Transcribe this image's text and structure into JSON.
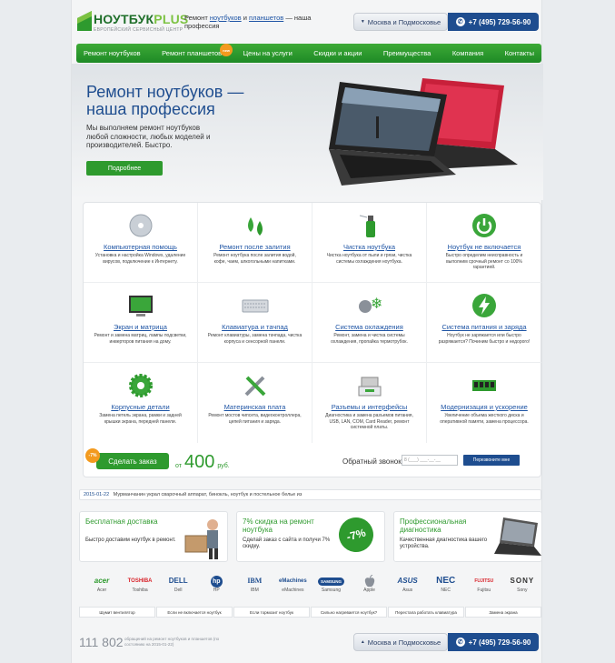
{
  "header": {
    "logo_text": "НОУТБУК",
    "logo_plus": "PLUS",
    "logo_sub": "ЕВРОПЕЙСКИЙ СЕРВИСНЫЙ ЦЕНТР",
    "tagline_pre": "Ремонт ",
    "tagline_link1": "ноутбуков",
    "tagline_mid": " и ",
    "tagline_link2": "планшетов",
    "tagline_post": " — наша профессия",
    "city": "Москва и Подмосковье",
    "phone": "+7 (495) 729-56-90"
  },
  "nav": {
    "items": [
      {
        "label": "Ремонт ноутбуков"
      },
      {
        "label": "Ремонт планшетов",
        "badge": "new"
      },
      {
        "label": "Цены на услуги"
      },
      {
        "label": "Скидки и акции"
      },
      {
        "label": "Преимущества"
      },
      {
        "label": "Компания"
      },
      {
        "label": "Контакты"
      }
    ]
  },
  "hero": {
    "title": "Ремонт ноутбуков — наша профессия",
    "text": "Мы выполняем ремонт ноутбуков любой сложности, любых моделей и производителей. Быстро.",
    "button": "Подробнее"
  },
  "services": [
    {
      "title": "Компьютерная помощь",
      "desc": "Установка и настройка Windows, удаление вирусов, подключение к Интернету.",
      "icon": "disc-icon"
    },
    {
      "title": "Ремонт после залития",
      "desc": "Ремонт ноутбука после залития водой, кофе, чаем, алкогольными напитками.",
      "icon": "drops-icon"
    },
    {
      "title": "Чистка ноутбука",
      "desc": "Чистка ноутбука от пыли и грязи, чистка системы охлаждения ноутбука.",
      "icon": "spray-icon"
    },
    {
      "title": "Ноутбук не включается",
      "desc": "Быстро определим неисправность и выполним срочный ремонт со 100% гарантией.",
      "icon": "power-icon"
    },
    {
      "title": "Экран и матрица",
      "desc": "Ремонт и замена матриц, лампы подсветки, инверторов питания на дому.",
      "icon": "screen-icon"
    },
    {
      "title": "Клавиатура и тачпад",
      "desc": "Ремонт клавиатуры, замена тачпада, чистка корпуса и сенсорной панели.",
      "icon": "keyboard-icon"
    },
    {
      "title": "Система охлаждения",
      "desc": "Ремонт, замена и чистка системы охлаждения, пропайка термотрубок.",
      "icon": "cooling-icon"
    },
    {
      "title": "Система питания и заряда",
      "desc": "Ноутбук не заряжается или быстро разряжается? Починим быстро и недорого!",
      "icon": "charge-icon"
    },
    {
      "title": "Корпусные детали",
      "desc": "Замена петель экрана, рамки и задней крышки экрана, передней панели.",
      "icon": "gear-icon"
    },
    {
      "title": "Материнская плата",
      "desc": "Ремонт мостов чипсета, видеоконтроллера, цепей питания и заряда.",
      "icon": "tools-icon"
    },
    {
      "title": "Разъемы и интерфейсы",
      "desc": "Диагностика и замена разъемов питания, USB, LAN, COM, Card Reader, ремонт системной платы.",
      "icon": "connector-icon"
    },
    {
      "title": "Модернизация и ускорение",
      "desc": "Увеличение объема жесткого диска и оперативной памяти, замена процессора.",
      "icon": "memory-icon"
    }
  ],
  "order": {
    "badge": "-7%",
    "button": "Сделать заказ",
    "from": "от",
    "price": "400",
    "currency": "руб.",
    "callback_label": "Обратный звонок",
    "callback_placeholder": "8 (___) ___-__-__",
    "callback_button": "Перезвоните мне"
  },
  "news": {
    "date": "2015-01-22",
    "text": "Мурманчанин украл сварочный аппарат, бинокль, ноутбук и постельное белье из"
  },
  "promos": [
    {
      "title": "Бесплатная доставка",
      "text": "Быстро доставим ноутбук в ремонт."
    },
    {
      "title": "7% скидка на ремонт ноутбука",
      "text": "Сделай заказ с сайта и получи 7% скидку.",
      "badge": "-7%"
    },
    {
      "title": "Профессиональная диагностика",
      "text": "Качественная диагностика вашего устройства."
    }
  ],
  "brands": [
    {
      "logo": "acer",
      "name": "Acer",
      "color": "#2e9a2e"
    },
    {
      "logo": "TOSHIBA",
      "name": "Toshiba",
      "color": "#d8232a"
    },
    {
      "logo": "DELL",
      "name": "Dell",
      "color": "#1e4d8f"
    },
    {
      "logo": "hp",
      "name": "HP",
      "color": "#1e4d8f"
    },
    {
      "logo": "IBM",
      "name": "IBM",
      "color": "#1e4d8f"
    },
    {
      "logo": "eMachines",
      "name": "eMachines",
      "color": "#1e4d8f"
    },
    {
      "logo": "SAMSUNG",
      "name": "Samsung",
      "color": "#1e4d8f"
    },
    {
      "logo": "",
      "name": "Apple",
      "color": "#888888"
    },
    {
      "logo": "ASUS",
      "name": "Asus",
      "color": "#1e4d8f"
    },
    {
      "logo": "NEC",
      "name": "NEC",
      "color": "#1e4d8f"
    },
    {
      "logo": "FUJITSU",
      "name": "Fujitsu",
      "color": "#d8232a"
    },
    {
      "logo": "SONY",
      "name": "Sony",
      "color": "#333333"
    }
  ],
  "tags": [
    "Шумит вентилятор",
    "Если не включается ноутбук",
    "Если тормозит ноутбук",
    "Сильно нагревается ноутбук?",
    "Перестала работать клавиатура",
    "Замена экрана"
  ],
  "footer": {
    "counter": "111 802",
    "counter_text": "обращений на ремонт ноутбуков и планшетов (по состоянию на 2015-01-22)",
    "city": "Москва и Подмосковье",
    "phone": "+7 (495) 729-56-90"
  }
}
